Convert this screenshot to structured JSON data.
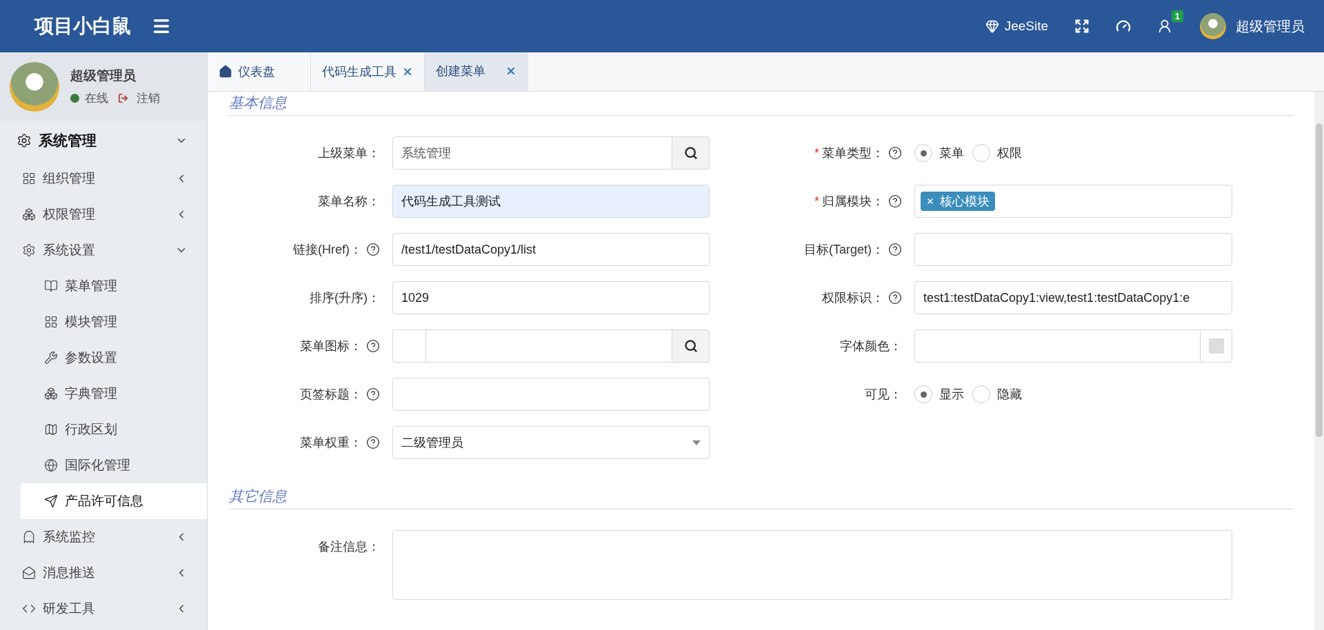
{
  "header": {
    "title": "项目小白鼠",
    "links": [
      {
        "kind": "brand",
        "label": "JeeSite"
      },
      {
        "kind": "fullscreen"
      },
      {
        "kind": "dashboard"
      },
      {
        "kind": "notifications",
        "badge": "1"
      }
    ],
    "user": {
      "name": "超级管理员"
    }
  },
  "sidebar": {
    "user": {
      "name": "超级管理员",
      "status": "在线",
      "logout": "注销"
    },
    "menu": [
      {
        "label": "系统管理",
        "kind": "gear",
        "expanded": true,
        "selected": false,
        "children": [
          {
            "label": "组织管理",
            "kind": "grid",
            "expanded": false,
            "selected": false
          },
          {
            "label": "权限管理",
            "kind": "boxes",
            "expanded": false,
            "selected": false
          },
          {
            "label": "系统设置",
            "kind": "gear",
            "expanded": true,
            "selected": false,
            "children": [
              {
                "label": "菜单管理",
                "kind": "book",
                "selected": false
              },
              {
                "label": "模块管理",
                "kind": "grid",
                "selected": false
              },
              {
                "label": "参数设置",
                "kind": "wrench",
                "selected": false
              },
              {
                "label": "字典管理",
                "kind": "boxes",
                "selected": false
              },
              {
                "label": "行政区划",
                "kind": "map",
                "selected": false
              },
              {
                "label": "国际化管理",
                "kind": "globe",
                "selected": false
              },
              {
                "label": "产品许可信息",
                "kind": "send",
                "selected": true
              }
            ]
          },
          {
            "label": "系统监控",
            "kind": "ghost",
            "expanded": false,
            "selected": false
          },
          {
            "label": "消息推送",
            "kind": "mail",
            "expanded": false,
            "selected": false
          },
          {
            "label": "研发工具",
            "kind": "code",
            "expanded": false,
            "selected": false
          }
        ]
      }
    ]
  },
  "tabs": [
    {
      "label": "仪表盘",
      "kind": "home",
      "closable": false,
      "selected": false
    },
    {
      "label": "代码生成工具",
      "closable": true,
      "selected": false
    },
    {
      "label": "创建菜单",
      "closable": true,
      "selected": true
    }
  ],
  "form": {
    "sections": [
      {
        "title": "基本信息",
        "rows": [
          [
            {
              "kind": "lookup",
              "label": "上级菜单：",
              "value": "系统管理"
            },
            {
              "kind": "radio",
              "label": "菜单类型：",
              "required_mark": "*",
              "help": true,
              "options": [
                {
                  "label": "菜单",
                  "selected": true
                },
                {
                  "label": "权限",
                  "selected": false
                }
              ]
            }
          ],
          [
            {
              "kind": "text",
              "label": "菜单名称：",
              "value": "代码生成工具测试",
              "autofilled": true
            },
            {
              "kind": "tags",
              "label": "归属模块：",
              "required_mark": "*",
              "help": true,
              "tags": [
                "核心模块"
              ]
            }
          ],
          [
            {
              "kind": "text",
              "label": "链接(Href)：",
              "help": true,
              "value": "/test1/testDataCopy1/list"
            },
            {
              "kind": "text",
              "label": "目标(Target)：",
              "help": true
            }
          ],
          [
            {
              "kind": "text",
              "label": "排序(升序)：",
              "value": "1029"
            },
            {
              "kind": "text",
              "label": "权限标识：",
              "help": true,
              "value": "test1:testDataCopy1:view,test1:testDataCopy1:e"
            }
          ],
          [
            {
              "kind": "icon-lookup",
              "label": "菜单图标：",
              "help": true
            },
            {
              "kind": "color",
              "label": "字体颜色："
            }
          ],
          [
            {
              "kind": "text",
              "label": "页签标题：",
              "help": true
            },
            {
              "kind": "radio",
              "label": "可见：",
              "options": [
                {
                  "label": "显示",
                  "selected": true
                },
                {
                  "label": "隐藏",
                  "selected": false
                }
              ]
            }
          ],
          [
            {
              "kind": "select",
              "label": "菜单权重：",
              "help": true,
              "value": "二级管理员"
            }
          ]
        ]
      },
      {
        "title": "其它信息",
        "rows": [
          [
            {
              "kind": "textarea",
              "label": "备注信息："
            }
          ]
        ]
      }
    ]
  }
}
